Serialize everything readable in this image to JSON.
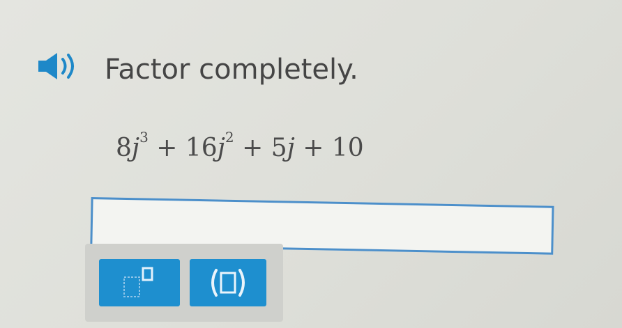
{
  "question": {
    "prompt": "Factor completely.",
    "expression": {
      "t1_coef": "8",
      "t1_var": "j",
      "t1_exp": "3",
      "op1": "+",
      "t2_coef": "16",
      "t2_var": "j",
      "t2_exp": "2",
      "op2": "+",
      "t3_coef": "5",
      "t3_var": "j",
      "op3": "+",
      "t4": "10"
    }
  },
  "answer": {
    "value": ""
  },
  "toolbar": {
    "buttons": [
      {
        "icon": "superscript-template-icon"
      },
      {
        "icon": "parentheses-template-icon"
      }
    ]
  },
  "colors": {
    "accent": "#1e8fcf",
    "input_border": "#4c8fca",
    "text": "#454545"
  }
}
